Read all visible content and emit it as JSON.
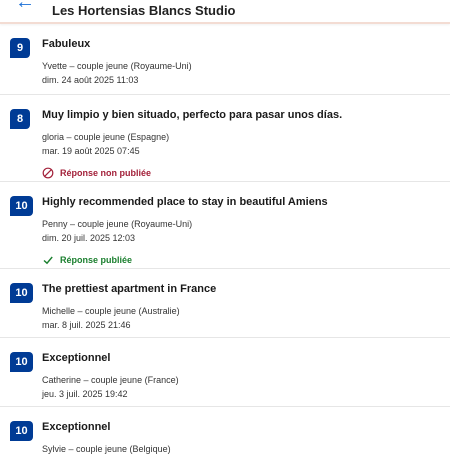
{
  "header": {
    "title": "Les Hortensias Blancs Studio",
    "back_icon": "arrow-left-icon"
  },
  "colors": {
    "score_bg": "#003b95",
    "unpublished": "#a3213a",
    "published": "#1a7f2e"
  },
  "reviews": [
    {
      "score": "9",
      "title": "Fabuleux",
      "author": "Yvette – couple jeune (Royaume-Uni)",
      "date": "dim. 24 août 2025 11:03",
      "status": ""
    },
    {
      "score": "8",
      "title": "Muy limpio y bien situado, perfecto para pasar unos días.",
      "author": "gloria – couple jeune (Espagne)",
      "date": "mar. 19 août 2025 07:45",
      "status": "Réponse non publiée"
    },
    {
      "score": "10",
      "title": "Highly recommended place to stay in beautiful Amiens",
      "author": "Penny – couple jeune (Royaume-Uni)",
      "date": "dim. 20 juil. 2025 12:03",
      "status": "Réponse publiée"
    },
    {
      "score": "10",
      "title": "The prettiest apartment in France",
      "author": "Michelle – couple jeune (Australie)",
      "date": "mar. 8 juil. 2025 21:46",
      "status": ""
    },
    {
      "score": "10",
      "title": "Exceptionnel",
      "author": "Catherine – couple jeune (France)",
      "date": "jeu. 3 juil. 2025 19:42",
      "status": ""
    },
    {
      "score": "10",
      "title": "Exceptionnel",
      "author": "Sylvie – couple jeune (Belgique)",
      "date": "",
      "status": ""
    }
  ]
}
